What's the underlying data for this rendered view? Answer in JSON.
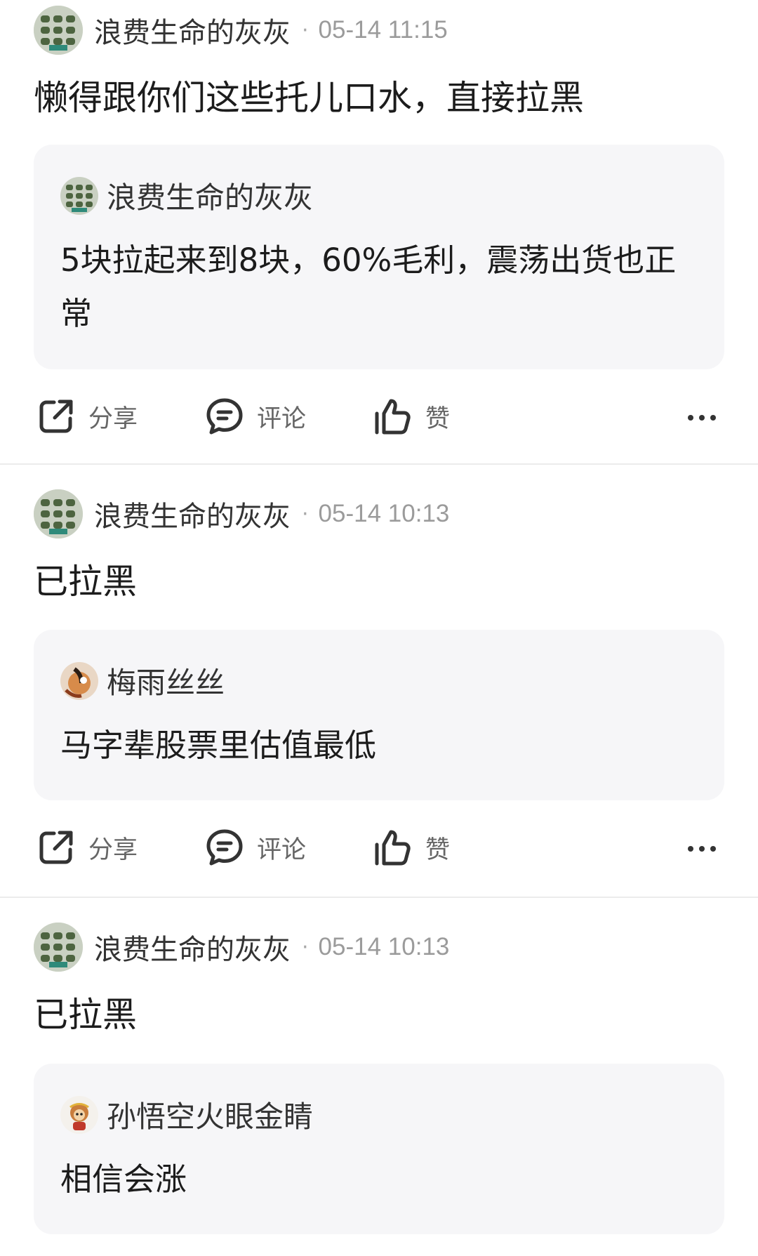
{
  "posts": [
    {
      "author": "浪费生命的灰灰",
      "time": "05-14 11:15",
      "content": "懒得跟你们这些托儿口水，直接拉黑",
      "quote": {
        "author": "浪费生命的灰灰",
        "text": "5块拉起来到8块，60%毛利，震荡出货也正常"
      }
    },
    {
      "author": "浪费生命的灰灰",
      "time": "05-14 10:13",
      "content": "已拉黑",
      "quote": {
        "author": "梅雨丝丝",
        "text": "马字辈股票里估值最低"
      }
    },
    {
      "author": "浪费生命的灰灰",
      "time": "05-14 10:13",
      "content": "已拉黑",
      "quote": {
        "author": "孙悟空火眼金睛",
        "text": "相信会涨"
      }
    }
  ],
  "actions": {
    "share": "分享",
    "comment": "评论",
    "like": "赞"
  },
  "separator": "·",
  "icons": [
    "share-icon",
    "comment-icon",
    "like-icon",
    "more-icon"
  ],
  "colors": {
    "quote_bg": "#f6f6f8",
    "divider": "#ececec",
    "meta": "#9b9b9b"
  }
}
